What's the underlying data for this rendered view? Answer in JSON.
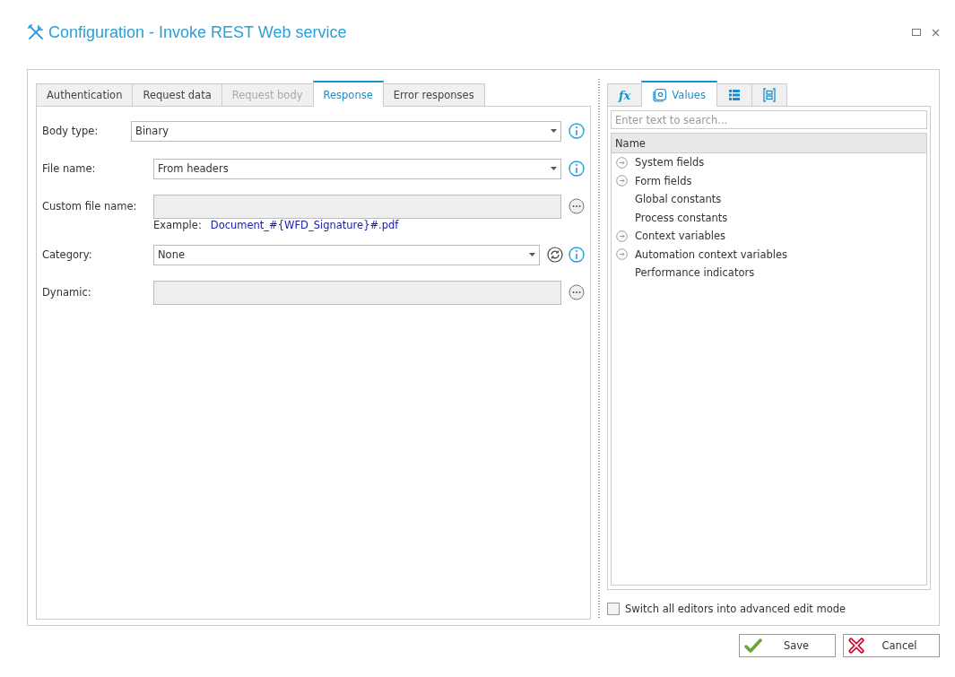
{
  "window": {
    "title": "Configuration - Invoke REST Web service"
  },
  "tabs": [
    {
      "label": "Authentication",
      "selected": false,
      "disabled": false
    },
    {
      "label": "Request data",
      "selected": false,
      "disabled": false
    },
    {
      "label": "Request body",
      "selected": false,
      "disabled": true
    },
    {
      "label": "Response",
      "selected": true,
      "disabled": false
    },
    {
      "label": "Error responses",
      "selected": false,
      "disabled": false
    }
  ],
  "fields": [
    {
      "kind": "select",
      "label": "Body type:",
      "value": "Binary",
      "narrow_label": true,
      "info": true
    },
    {
      "kind": "select",
      "label": "File name:",
      "value": "From headers",
      "narrow_label": false,
      "info": true
    },
    {
      "kind": "text",
      "label": "Custom file name:",
      "narrow_label": false,
      "more": true
    },
    {
      "kind": "example",
      "label": "Example:",
      "value": "Document_#{WFD_Signature}#.pdf"
    },
    {
      "kind": "select",
      "label": "Category:",
      "value": "None",
      "narrow_label": false,
      "info": true,
      "refresh": true
    },
    {
      "kind": "text",
      "label": "Dynamic:",
      "narrow_label": false,
      "more": true
    }
  ],
  "side_tabs": [
    {
      "kind": "fx",
      "selected": false
    },
    {
      "kind": "values",
      "label": "Values",
      "selected": true
    },
    {
      "kind": "list",
      "selected": false
    },
    {
      "kind": "bracket",
      "selected": false
    }
  ],
  "search": {
    "placeholder": "Enter text to search..."
  },
  "tree": {
    "column": "Name",
    "items": [
      {
        "label": "System fields",
        "expandable": true
      },
      {
        "label": "Form fields",
        "expandable": true
      },
      {
        "label": "Global constants",
        "expandable": false
      },
      {
        "label": "Process constants",
        "expandable": false
      },
      {
        "label": "Context variables",
        "expandable": true
      },
      {
        "label": "Automation context variables",
        "expandable": true
      },
      {
        "label": "Performance indicators",
        "expandable": false
      }
    ]
  },
  "advanced_mode": {
    "label": "Switch all editors into advanced edit mode",
    "checked": false
  },
  "buttons": [
    {
      "kind": "save",
      "label": "Save"
    },
    {
      "kind": "cancel",
      "label": "Cancel"
    }
  ]
}
